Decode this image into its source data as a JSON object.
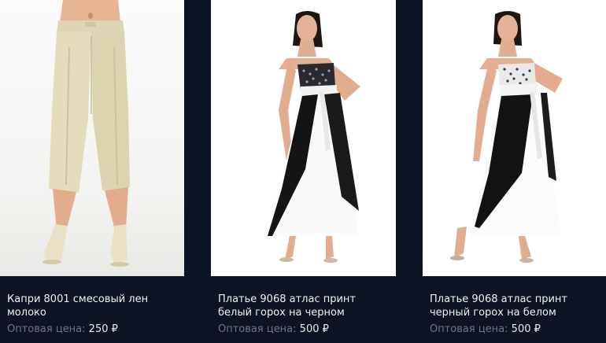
{
  "products": [
    {
      "title": "Капри 8001 смесовый лен молоко",
      "price_label": "Оптовая цена:",
      "price_value": "250",
      "currency": "₽"
    },
    {
      "title": "Платье 9068 атлас принт белый горох на черном",
      "price_label": "Оптовая цена:",
      "price_value": "500",
      "currency": "₽"
    },
    {
      "title": "Платье 9068 атлас принт черный горох на белом",
      "price_label": "Оптовая цена:",
      "price_value": "500",
      "currency": "₽"
    }
  ],
  "colors": {
    "background": "#0c1322",
    "title_text": "#f2f2f2",
    "price_label_text": "#6d7584"
  }
}
